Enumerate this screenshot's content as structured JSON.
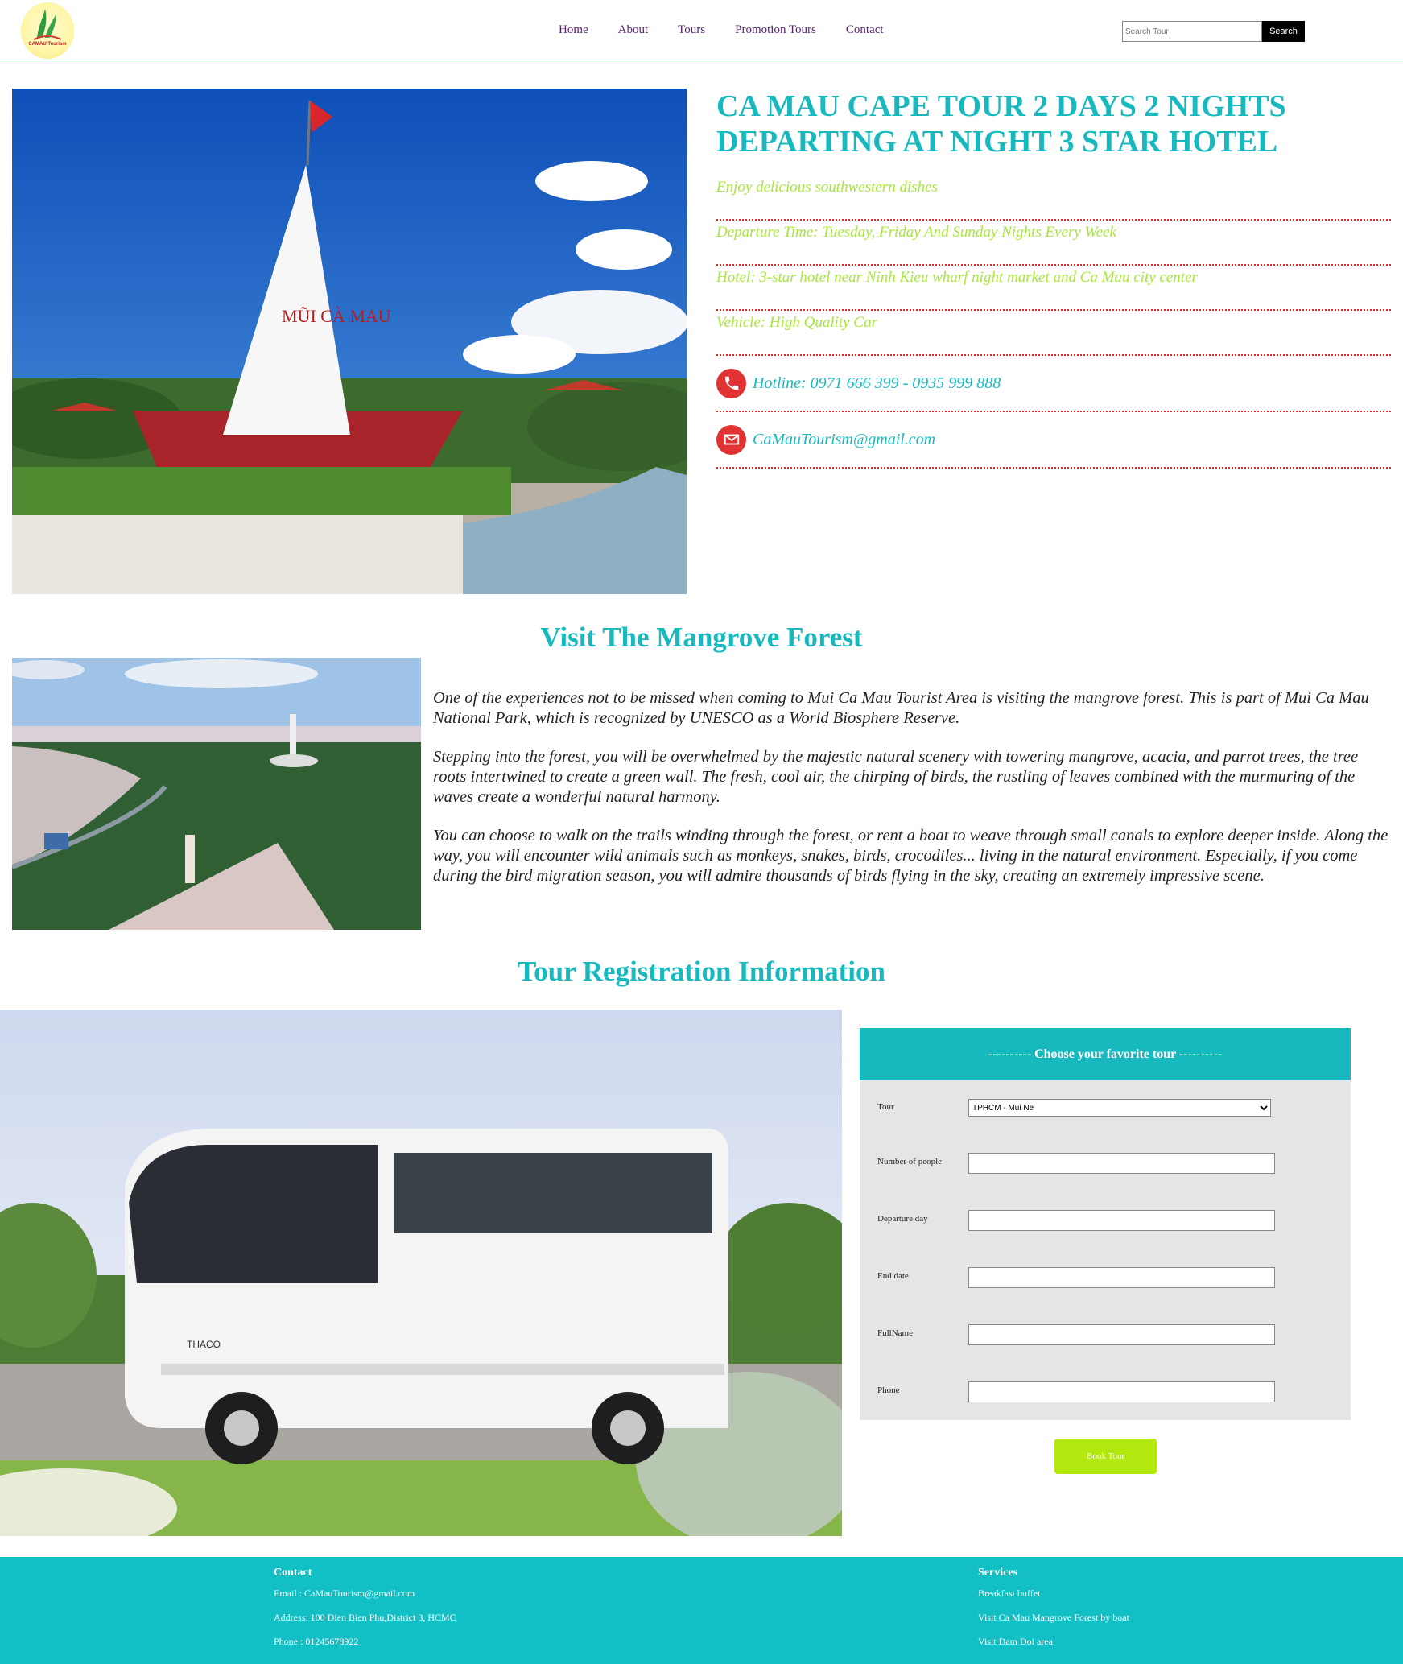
{
  "header": {
    "logo_text": "CAMAU Tourism",
    "nav": [
      "Home",
      "About",
      "Tours",
      "Promotion Tours",
      "Contact"
    ],
    "search_placeholder": "Search Tour",
    "search_button": "Search"
  },
  "hero": {
    "title": "CA MAU CAPE TOUR 2 DAYS 2 NIGHTS DEPARTING AT NIGHT 3 STAR HOTEL",
    "info": [
      "Enjoy delicious southwestern dishes",
      "Departure Time: Tuesday, Friday And Sunday Nights Every Week",
      "Hotel: 3-star hotel near Ninh Kieu wharf night market and Ca Mau city center",
      "Vehicle: High Quality Car"
    ],
    "hotline": "Hotline: 0971 666 399 - 0935 999 888",
    "email": "CaMauTourism@gmail.com",
    "monument_text": "MŨI CÀ MAU"
  },
  "mangrove": {
    "title": "Visit The Mangrove Forest",
    "paragraphs": [
      "One of the experiences not to be missed when coming to Mui Ca Mau Tourist Area is visiting the mangrove forest. This is part of Mui Ca Mau National Park, which is recognized by UNESCO as a World Biosphere Reserve.",
      "Stepping into the forest, you will be overwhelmed by the majestic natural scenery with towering mangrove, acacia, and parrot trees, the tree roots intertwined to create a green wall. The fresh, cool air, the chirping of birds, the rustling of leaves combined with the murmuring of the waves create a wonderful natural harmony.",
      "You can choose to walk on the trails winding through the forest, or rent a boat to weave through small canals to explore deeper inside. Along the way, you will encounter wild animals such as monkeys, snakes, birds, crocodiles... living in the natural environment. Especially, if you come during the bird migration season, you will admire thousands of birds flying in the sky, creating an extremely impressive scene."
    ]
  },
  "registration": {
    "title": "Tour Registration Information",
    "form_heading": "---------- Choose your favorite tour ----------",
    "tour_label": "Tour",
    "tour_selected": "TPHCM - Mui Ne",
    "fields": [
      "Number of people",
      "Departure day",
      "End date",
      "FullName",
      "Phone"
    ],
    "book_button": "Book Tour",
    "bus_text": "THACO"
  },
  "footer": {
    "contact_title": "Contact",
    "contact_lines": [
      "Email : CaMauTourism@gmail.com",
      "Address: 100 Dien Bien Phu,District 3, HCMC",
      "Phone : 01245678922"
    ],
    "services_title": "Services",
    "services_lines": [
      "Breakfast buffet",
      "Visit Ca Mau Mangrove Forest by boat",
      "Visit Dam Doi area"
    ]
  },
  "colors": {
    "accent": "#17b9bf",
    "info_text": "#a6e63a",
    "dotted_rule": "#d42a2a",
    "nav_text": "#5a2374",
    "book_button": "#b2e810",
    "footer_bg": "#12bfc5"
  }
}
